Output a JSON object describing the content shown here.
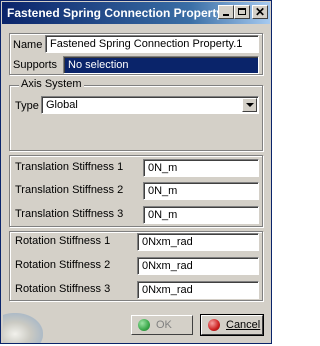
{
  "window": {
    "title": "Fastened Spring Connection Property",
    "controls": {
      "minimize_icon": "minimize-icon",
      "maximize_icon": "maximize-icon",
      "close_symbol": "✕"
    }
  },
  "name": {
    "label": "Name",
    "value": "Fastened Spring Connection Property.1"
  },
  "supports": {
    "label": "Supports",
    "value": "No selection"
  },
  "axis_system": {
    "group_title": "Axis System",
    "type_label": "Type",
    "type_value": "Global"
  },
  "translation": [
    {
      "label": "Translation Stiffness 1",
      "value": "0N_m"
    },
    {
      "label": "Translation Stiffness 2",
      "value": "0N_m"
    },
    {
      "label": "Translation Stiffness 3",
      "value": "0N_m"
    }
  ],
  "rotation": [
    {
      "label": "Rotation Stiffness 1",
      "value": "0Nxm_rad"
    },
    {
      "label": "Rotation Stiffness 2",
      "value": "0Nxm_rad"
    },
    {
      "label": "Rotation Stiffness 3",
      "value": "0Nxm_rad"
    }
  ],
  "buttons": {
    "ok": {
      "label": "OK",
      "state": "disabled",
      "icon_color": "#3aa84a"
    },
    "cancel": {
      "label": "Cancel",
      "icon_color": "#cc2020"
    }
  },
  "colors": {
    "title_bar": "#0a246a",
    "selection": "#0a246a",
    "face": "#d4d0c8"
  }
}
